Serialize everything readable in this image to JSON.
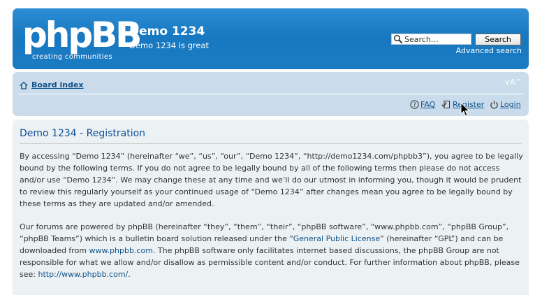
{
  "header": {
    "logo_text": "phpBB",
    "logo_tagline": "creating communities",
    "site_title": "Demo 1234",
    "site_description": "Demo 1234 is great",
    "search": {
      "placeholder": "Search…",
      "value": "Search…",
      "button_label": "Search"
    },
    "advanced_search_label": "Advanced search"
  },
  "navbar": {
    "breadcrumb": "Board index",
    "font_size_control": "∨A^",
    "links": {
      "faq": "FAQ",
      "register": "Register",
      "login": "Login"
    }
  },
  "main": {
    "title": "Demo 1234 - Registration",
    "para1": "By accessing “Demo 1234” (hereinafter “we”, “us”, “our”, “Demo 1234”, “http://demo1234.com/phpbb3”), you agree to be legally bound by the following terms. If you do not agree to be legally bound by all of the following terms then please do not access and/or use “Demo 1234”. We may change these at any time and we’ll do our utmost in informing you, though it would be prudent to review this regularly yourself as your continued usage of “Demo 1234” after changes mean you agree to be legally bound by these terms as they are updated and/or amended.",
    "para2": {
      "part1": "Our forums are powered by phpBB (hereinafter “they”, “them”, “their”, “phpBB software”, “www.phpbb.com”, “phpBB Group”, “phpBB Teams”) which is a bulletin board solution released under the “",
      "gpl_link": "General Public License",
      "part2": "” (hereinafter “GPL”) and can be downloaded from ",
      "phpbb_link": "www.phpbb.com",
      "part3": ". The phpBB software only facilitates internet based discussions, the phpBB Group are not responsible for what we allow and/or disallow as permissible content and/or conduct. For further information about phpBB, please see: ",
      "phpbb_url_link": "http://www.phpbb.com/",
      "part4": "."
    }
  },
  "colors": {
    "header_bg": "#1a78c2",
    "navbar_bg": "#cadceb",
    "content_bg": "#ecf1f3",
    "link": "#105289",
    "title": "#115098"
  }
}
